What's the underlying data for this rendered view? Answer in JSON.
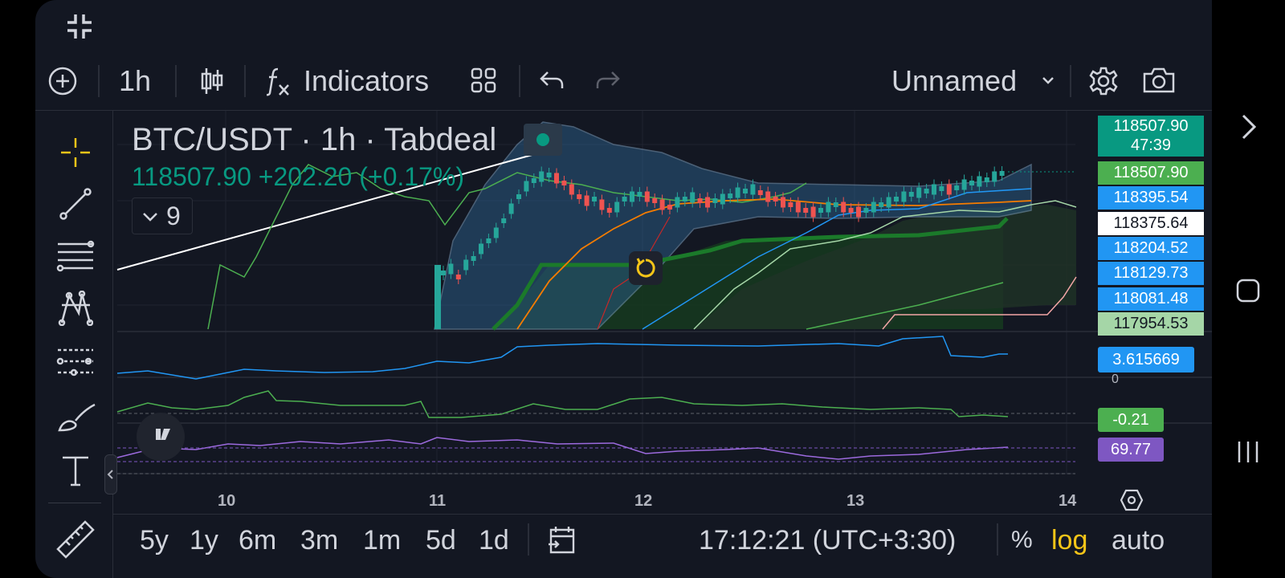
{
  "toolbar": {
    "interval": "1h",
    "indicators_label": "Indicators",
    "layout_name": "Unnamed"
  },
  "symbol": {
    "title": "BTC/USDT · 1h · Tabdeal",
    "price_line": "118507.90 +202.20 (+0.17%)",
    "collapse_count": "9"
  },
  "price_scale": {
    "labels": [
      {
        "text": "118507.90",
        "sub": "47:39",
        "color": "#089981"
      },
      {
        "text": "118507.90",
        "color": "#4caf50"
      },
      {
        "text": "118395.54",
        "color": "#2196f3"
      },
      {
        "text": "118375.64",
        "color": "#ffffff"
      },
      {
        "text": "118204.52",
        "color": "#2196f3"
      },
      {
        "text": "118129.73",
        "color": "#2196f3"
      },
      {
        "text": "118081.48",
        "color": "#2196f3"
      },
      {
        "text": "117954.53",
        "color": "#a5d6a7"
      }
    ]
  },
  "panes": {
    "pane1_value": "3.615669",
    "pane1_zero": "0",
    "pane2_value": "-0.21",
    "pane3_value": "69.77"
  },
  "time_axis": {
    "ticks": [
      "10",
      "11",
      "12",
      "13",
      "14"
    ]
  },
  "bottom_bar": {
    "ranges": [
      "5y",
      "1y",
      "6m",
      "3m",
      "1m",
      "5d",
      "1d"
    ],
    "clock": "17:12:21 (UTC+3:30)",
    "percent": "%",
    "log": "log",
    "auto": "auto"
  },
  "colors": {
    "background": "#131722",
    "up": "#26a69a",
    "down": "#ef5350",
    "accent_yellow": "#f5c518",
    "blue": "#2196f3"
  },
  "icons": [
    "compress-icon",
    "add-circle-icon",
    "candles-icon",
    "fx-icon",
    "templates-icon",
    "undo-icon",
    "redo-icon",
    "chevron-down-icon",
    "gear-icon",
    "camera-icon",
    "crosshair-icon",
    "trendline-icon",
    "fib-icon",
    "pattern-icon",
    "prediction-icon",
    "brush-icon",
    "text-icon",
    "ruler-icon",
    "calendar-icon",
    "hexagon-settings-icon",
    "reset-icon",
    "chevron-right-icon",
    "android-home-icon",
    "android-recents-icon"
  ]
}
